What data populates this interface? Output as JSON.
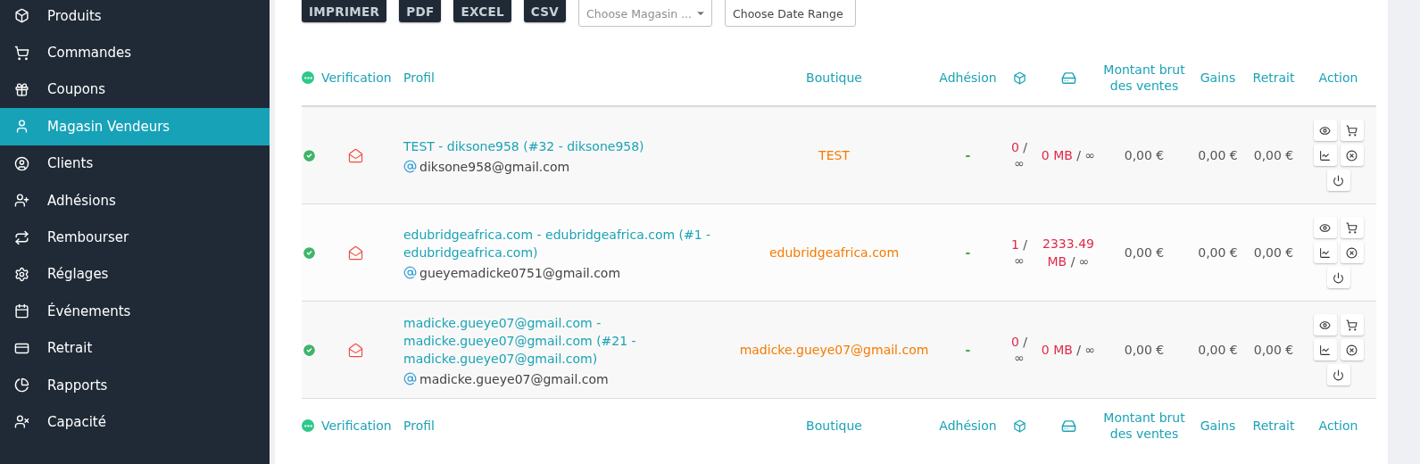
{
  "sidebar": {
    "items": [
      {
        "label": "Produits",
        "selected": false
      },
      {
        "label": "Commandes",
        "selected": false
      },
      {
        "label": "Coupons",
        "selected": false
      },
      {
        "label": "Magasin Vendeurs",
        "selected": true
      },
      {
        "label": "Clients",
        "selected": false
      },
      {
        "label": "Adhésions",
        "selected": false
      },
      {
        "label": "Rembourser",
        "selected": false
      },
      {
        "label": "Réglages",
        "selected": false
      },
      {
        "label": "Événements",
        "selected": false
      },
      {
        "label": "Retrait",
        "selected": false
      },
      {
        "label": "Rapports",
        "selected": false
      },
      {
        "label": "Capacité",
        "selected": false
      }
    ]
  },
  "toolbar": {
    "buttons": [
      "IMPRIMER",
      "PDF",
      "EXCEL",
      "CSV"
    ],
    "store_select": {
      "placeholder": "Choose Magasin ..."
    },
    "date_range": {
      "placeholder": "Choose Date Range"
    }
  },
  "table": {
    "columns": [
      "Verification",
      "Profil",
      "Boutique",
      "Adhésion",
      "Montant brut des ventes",
      "Gains",
      "Retrait",
      "Action"
    ],
    "rows": [
      {
        "verified": true,
        "email_verified": false,
        "profile": "TEST - diksone958 (#32 - diksone958)",
        "email": "diksone958@gmail.com",
        "boutique": "TEST",
        "adhesion": "-",
        "products_used": "0",
        "products_limit": "/ ∞",
        "storage_used": "0 MB",
        "storage_limit": "/ ∞",
        "gross_sales": "0,00 €",
        "gains": "0,00 €",
        "withdrawal": "0,00 €"
      },
      {
        "verified": true,
        "email_verified": false,
        "profile": "edubridgeafrica.com - edubridgeafrica.com (#1 - edubridgeafrica.com)",
        "email": "gueyemadicke0751@gmail.com",
        "boutique": "edubridgeafrica.com",
        "adhesion": "-",
        "products_used": "1",
        "products_limit": "/ ∞",
        "storage_used": "2333.49 MB",
        "storage_limit": "/ ∞",
        "gross_sales": "0,00 €",
        "gains": "0,00 €",
        "withdrawal": "0,00 €"
      },
      {
        "verified": true,
        "email_verified": false,
        "profile": "madicke.gueye07@gmail.com - madicke.gueye07@gmail.com (#21 - madicke.gueye07@gmail.com)",
        "email": "madicke.gueye07@gmail.com",
        "boutique": "madicke.gueye07@gmail.com",
        "adhesion": "-",
        "products_used": "0",
        "products_limit": "/ ∞",
        "storage_used": "0 MB",
        "storage_limit": "/ ∞",
        "gross_sales": "0,00 €",
        "gains": "0,00 €",
        "withdrawal": "0,00 €"
      }
    ],
    "footer_columns": [
      "Verification",
      "Profil",
      "Boutique",
      "Adhésion",
      "Montant brut des ventes",
      "Gains",
      "Retrait",
      "Action"
    ]
  }
}
